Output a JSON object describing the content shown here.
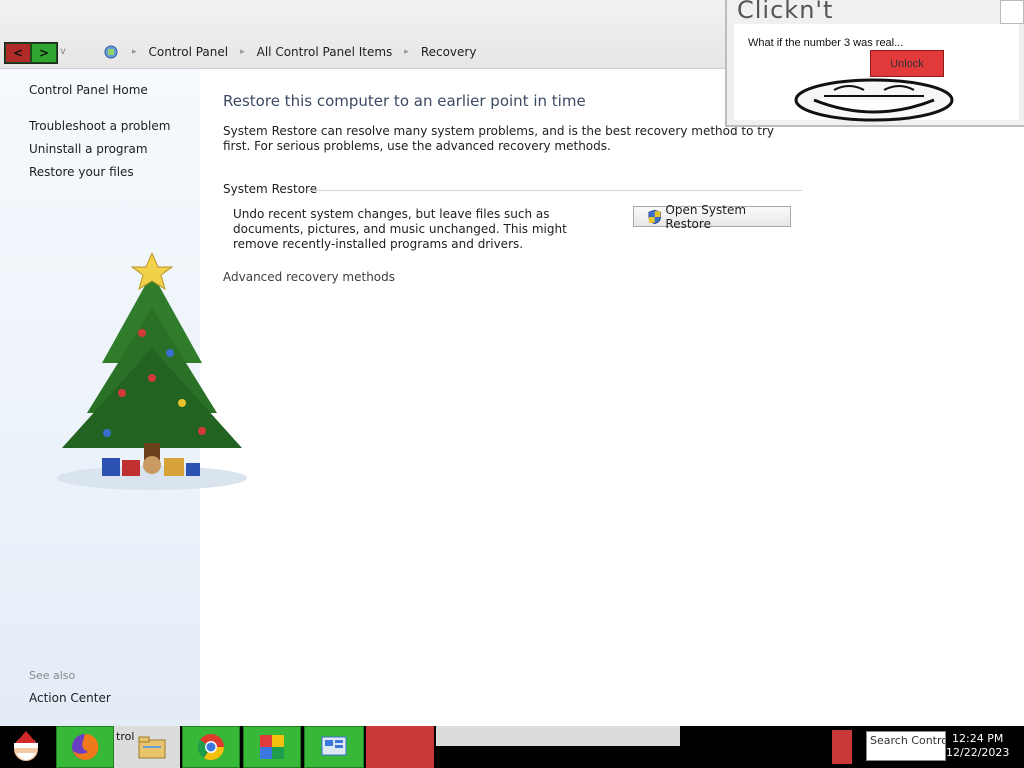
{
  "nav": {
    "back_glyph": "<",
    "forward_glyph": ">",
    "dropdown_glyph": "v",
    "breadcrumbs": [
      "Control Panel",
      "All Control Panel Items",
      "Recovery"
    ]
  },
  "sidebar": {
    "home": "Control Panel Home",
    "links": [
      "Troubleshoot a problem",
      "Uninstall a program",
      "Restore your files"
    ],
    "see_also_label": "See also",
    "see_also_links": [
      "Action Center"
    ]
  },
  "main": {
    "title": "Restore this computer to an earlier point in time",
    "intro": "System Restore can resolve many system problems, and is the best recovery method to try first. For serious problems, use the advanced recovery methods.",
    "section_title": "System Restore",
    "section_text": "Undo recent system changes, but leave files such as documents, pictures, and music unchanged. This might remove recently-installed programs and drivers.",
    "open_restore_button": "Open System Restore",
    "advanced_link": "Advanced recovery methods"
  },
  "popup": {
    "title": "Clickn't",
    "message": "What if the number 3 was real...",
    "unlock_button": "Unlock"
  },
  "taskbar": {
    "partial_label": "trol",
    "search_text": "Search Control",
    "time": "12:24 PM",
    "date": "12/22/2023"
  },
  "colors": {
    "accent_green": "#38b838",
    "accent_red": "#c83a3a",
    "title_blue": "#3b4a63",
    "sidebar_bg": "#eaf1f9"
  }
}
